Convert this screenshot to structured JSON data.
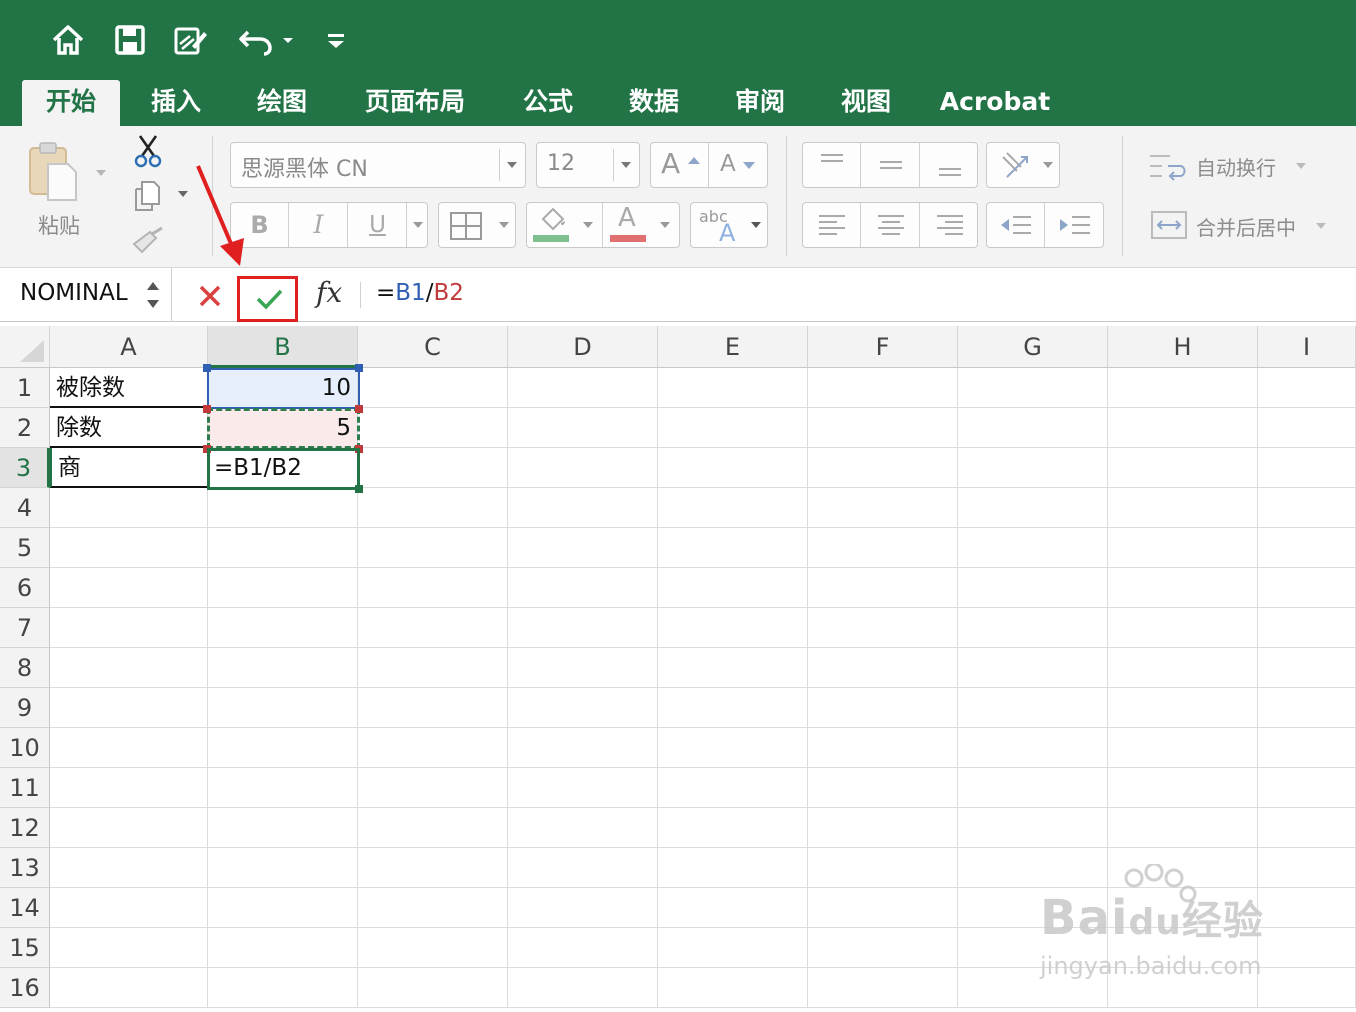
{
  "quick_access": {
    "icons": [
      "home-icon",
      "save-icon",
      "edit-icon",
      "undo-icon",
      "dropdown-icon",
      "customize-icon"
    ]
  },
  "ribbon_tabs": [
    {
      "label": "开始",
      "active": true
    },
    {
      "label": "插入"
    },
    {
      "label": "绘图"
    },
    {
      "label": "页面布局"
    },
    {
      "label": "公式"
    },
    {
      "label": "数据"
    },
    {
      "label": "审阅"
    },
    {
      "label": "视图"
    },
    {
      "label": "Acrobat"
    }
  ],
  "ribbon": {
    "paste_label": "粘贴",
    "font_name": "思源黑体 CN",
    "font_size": "12",
    "grow_font": "A",
    "shrink_font": "A",
    "bold": "B",
    "italic": "I",
    "underline": "U",
    "font_color_letter": "A",
    "fill_color": "#7fc08f",
    "font_color": "#e05a5a",
    "abc_label": "abc",
    "wrap_text_label": "自动换行",
    "merge_center_label": "合并后居中"
  },
  "formula_bar": {
    "name_box": "NOMINAL",
    "fx": "fx",
    "formula_prefix": "=",
    "ref1": "B1",
    "slash": "/",
    "ref2": "B2"
  },
  "columns": [
    "A",
    "B",
    "C",
    "D",
    "E",
    "F",
    "G",
    "H",
    "I"
  ],
  "rows": [
    "1",
    "2",
    "3",
    "4",
    "5",
    "6",
    "7",
    "8",
    "9",
    "10",
    "11",
    "12",
    "13",
    "14",
    "15",
    "16"
  ],
  "cells": {
    "A1": "被除数",
    "B1": "10",
    "A2": "除数",
    "B2": "5",
    "A3": "商",
    "B3": "=B1/B2"
  },
  "colors": {
    "excel_green": "#227447",
    "ref1_blue": "#2f5fb3",
    "ref2_red": "#c0393b",
    "highlight_red": "#e02020"
  },
  "watermark": {
    "brand": "Bai",
    "brand2": "du",
    "cn": "经验",
    "url": "jingyan.baidu.com"
  }
}
